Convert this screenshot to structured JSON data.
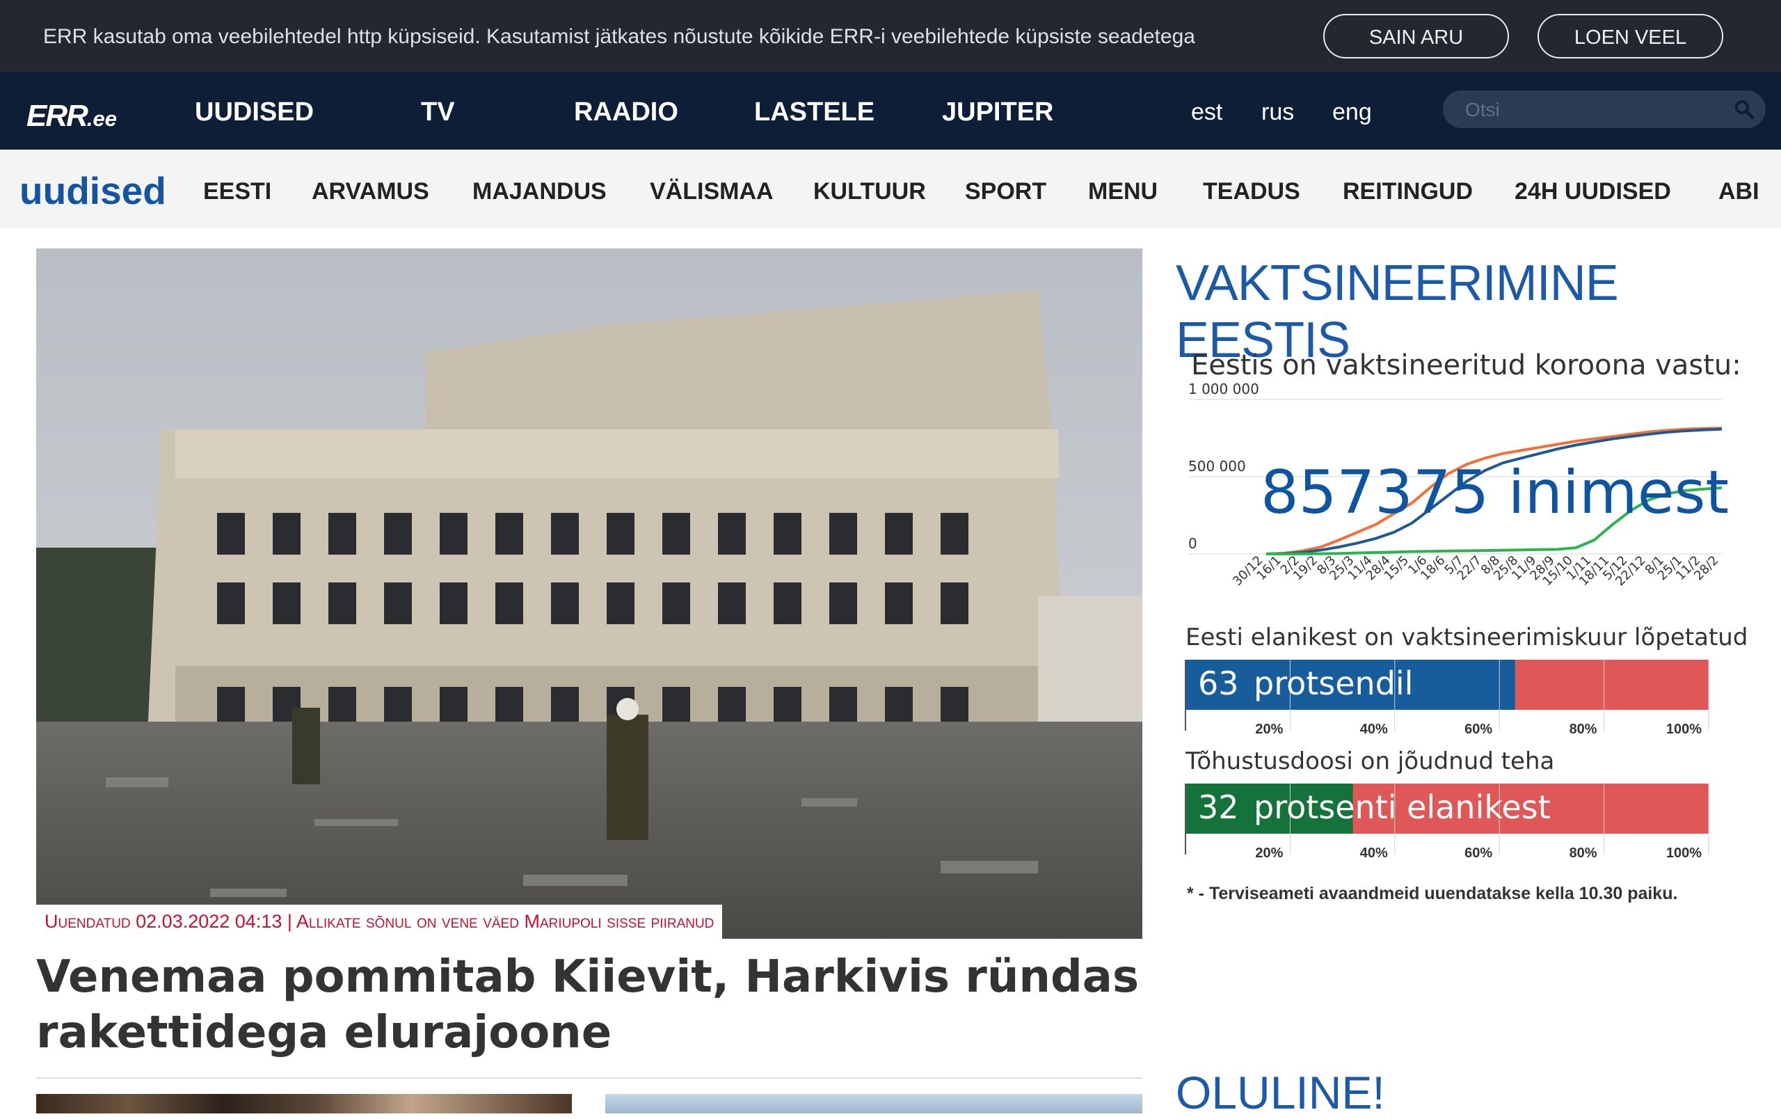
{
  "cookie": {
    "text": "ERR kasutab oma veebilehtedel http küpsiseid. Kasutamist jätkates nõustute kõikide ERR-i veebilehtede küpsiste seadetega",
    "accept_label": "SAIN ARU",
    "more_label": "LOEN VEEL"
  },
  "topnav": {
    "logo_main": "ERR",
    "logo_suffix": ".ee",
    "items": [
      "UUDISED",
      "TV",
      "RAADIO",
      "LASTELE",
      "JUPITER"
    ],
    "langs": [
      "est",
      "rus",
      "eng"
    ],
    "search_placeholder": "Otsi"
  },
  "secnav": {
    "brand": "uudised",
    "items": [
      "EESTI",
      "ARVAMUS",
      "MAJANDUS",
      "VÄLISMAA",
      "KULTUUR",
      "SPORT",
      "MENU",
      "TEADUS",
      "REITINGUD",
      "24H UUDISED",
      "ABI"
    ]
  },
  "main": {
    "caption": "Uuendatud 02.03.2022 04:13 | Allikate sõnul on vene väed Mariupoli sisse piiranud",
    "headline": "Venemaa pommitab Kiievit, Harkivis ründas rakettidega elurajoone"
  },
  "sidebar": {
    "title": "VAKTSINEERIMINE EESTIS",
    "subtitle": "Eestis on vaktsineeritud koroona vastu:",
    "count": "857375",
    "count_unit": "inimest",
    "bar1_label": "Eesti elanikest on vaktsineerimiskuur lõpetatud",
    "bar1_value_text": "63",
    "bar1_unit": "protsendil",
    "bar2_label": "Tõhustusdoosi on jõudnud teha",
    "bar2_value_text": "32",
    "bar2_unit": "protsenti elanikest",
    "note": "* - Terviseameti avaandmeid uuendatakse kella 10.30 paiku.",
    "oluline": "OLULINE!"
  },
  "colors": {
    "orange": "#f2703a",
    "blue": "#1e5a96",
    "green": "#2fb34e",
    "lightblue": "#8fb6d6",
    "bar_blue": "#175d9b",
    "bar_green": "#13733a",
    "bar_red": "#e05757"
  },
  "chart_data": [
    {
      "type": "line",
      "title": "",
      "y_tick_labels": [
        "1 000 000",
        "500 000",
        "0"
      ],
      "ylim": [
        0,
        1000000
      ],
      "x": [
        "30/12",
        "16/1",
        "2/2",
        "19/2",
        "8/3",
        "25/3",
        "11/4",
        "28/4",
        "15/5",
        "1/6",
        "18/6",
        "5/7",
        "22/7",
        "8/8",
        "25/8",
        "11/9",
        "28/9",
        "15/10",
        "1/11",
        "18/11",
        "5/12",
        "22/12",
        "8/1",
        "25/1",
        "11/2",
        "28/2"
      ],
      "series": [
        {
          "values": [
            0,
            5000,
            20000,
            45000,
            90000,
            140000,
            190000,
            260000,
            330000,
            430000,
            520000,
            580000,
            620000,
            650000,
            670000,
            690000,
            710000,
            730000,
            745000,
            760000,
            775000,
            790000,
            800000,
            808000,
            812000,
            815000
          ]
        },
        {
          "values": [
            0,
            2000,
            10000,
            25000,
            45000,
            70000,
            100000,
            140000,
            200000,
            290000,
            380000,
            470000,
            540000,
            590000,
            620000,
            650000,
            680000,
            705000,
            725000,
            745000,
            760000,
            775000,
            788000,
            797000,
            803000,
            808000
          ]
        },
        {
          "values": [
            0,
            0,
            500,
            1000,
            3000,
            6000,
            9000,
            12000,
            15000,
            17000,
            19000,
            20000,
            22000,
            24000,
            26000,
            28000,
            30000,
            40000,
            90000,
            190000,
            280000,
            350000,
            390000,
            410000,
            420000,
            428000
          ]
        }
      ]
    },
    {
      "type": "bar",
      "categories": [
        "vaktsineerimiskuur lõpetatud"
      ],
      "values": [
        63
      ],
      "x_tick_labels": [
        "20%",
        "40%",
        "60%",
        "80%",
        "100%"
      ],
      "xlim": [
        0,
        100
      ]
    },
    {
      "type": "bar",
      "categories": [
        "tõhustusdoos"
      ],
      "values": [
        32
      ],
      "x_tick_labels": [
        "20%",
        "40%",
        "60%",
        "80%",
        "100%"
      ],
      "xlim": [
        0,
        100
      ]
    }
  ]
}
